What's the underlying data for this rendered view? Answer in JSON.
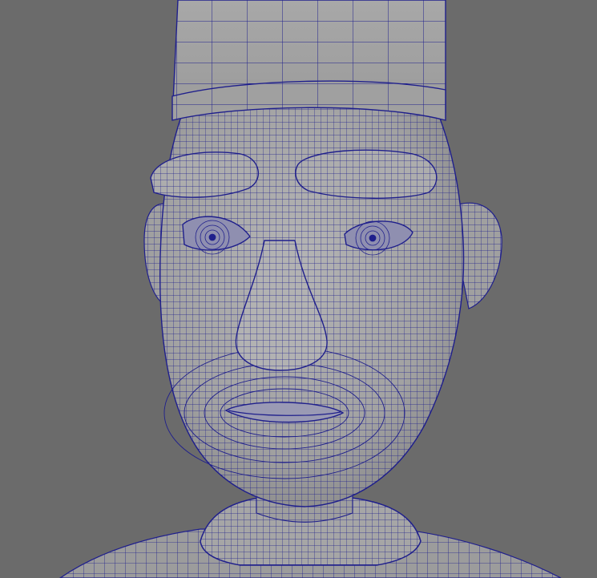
{
  "viewport": {
    "background_color": "#6b6b6b",
    "mesh_fill_color": "#a3a3a3",
    "wireframe_color": "#1f1f8c"
  }
}
